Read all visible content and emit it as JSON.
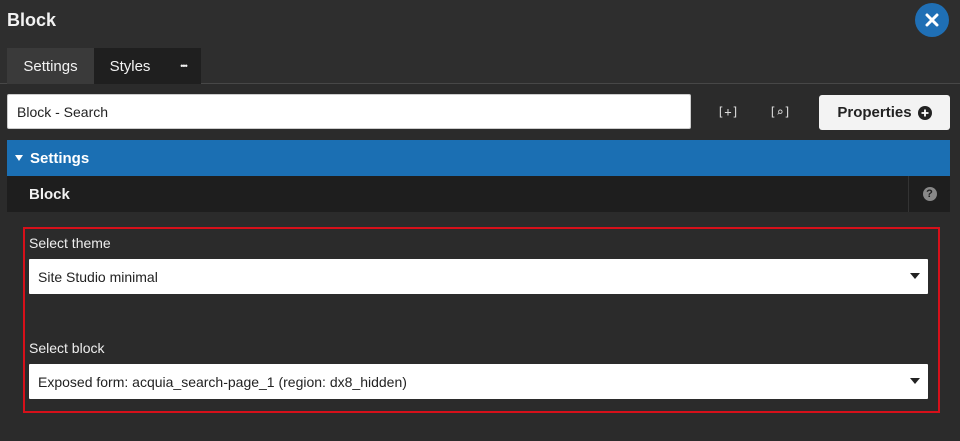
{
  "window": {
    "title": "Block"
  },
  "tabs": [
    {
      "label": "Settings"
    },
    {
      "label": "Styles"
    },
    {
      "label": "•••"
    }
  ],
  "toolbar": {
    "name_value": "Block - Search",
    "expand_glyph": "[+]",
    "search_glyph": "[⌕]",
    "properties_label": "Properties"
  },
  "section": {
    "title": "Settings"
  },
  "block_panel": {
    "title": "Block",
    "help_glyph": "?"
  },
  "fields": {
    "theme": {
      "label": "Select theme",
      "value": "Site Studio minimal"
    },
    "block": {
      "label": "Select block",
      "value": "Exposed form: acquia_search-page_1 (region: dx8_hidden)"
    }
  },
  "colors": {
    "accent_blue": "#1b6fb3",
    "highlight_red": "#d6101a",
    "background": "#2b2b2b"
  }
}
